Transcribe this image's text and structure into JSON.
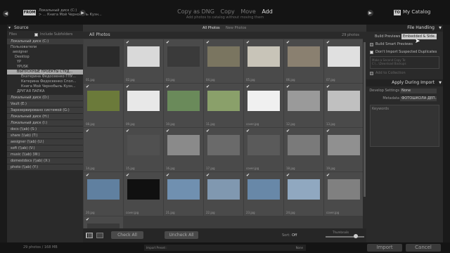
{
  "source": {
    "badge": "FROM",
    "line1": "Локальный диск (C:)",
    "line2": "> ... Книга Мой Чернобыль Кузн..."
  },
  "modes": {
    "copy_dng": "Copy as DNG",
    "copy": "Copy",
    "move": "Move",
    "add": "Add",
    "subtitle": "Add photos to catalog without moving them"
  },
  "dest": {
    "badge": "TO",
    "label": "My Catalog"
  },
  "left": {
    "title": "Source",
    "files_label": "Files",
    "include_subfolders": "Include Subfolders",
    "drives_top": [
      "Локальный диск (C:)"
    ],
    "tree": [
      "Пользователи",
      "aesigner",
      "Desktop",
      "YP",
      "YPUSK",
      "ВЫПУСКНЫЕ ПРОЕКТЫ СТУД...",
      "Екатерина Федосеенко ГПУ...",
      "Катерина Федосеенко Спол...",
      "Книга Мой Чернобыль Кузн...",
      "ДРУГАЯ ПАПКА"
    ],
    "drives": [
      "Локальный диск (D:)",
      "Vault (E:)",
      "Зарезервировано системой (G:)",
      "Локальный диск (H:)",
      "Локальный диск (I:)",
      "docs (\\\\ab) (S:)",
      "share (\\\\ab) (T:)",
      "aesigner (\\\\ab) (U:)",
      "soft (\\\\ab) (V:)",
      "music (\\\\ab) (W:)",
      "domestdocs (\\\\ab) (X:)",
      "photo (\\\\ab) (Y:)"
    ]
  },
  "center": {
    "tab_all": "All Photos",
    "tab_new": "New Photos",
    "grid_title": "All Photos",
    "count": "29 photos",
    "check_all": "Check All",
    "uncheck_all": "Uncheck All",
    "sort_label": "Sort:",
    "sort_value": "Off",
    "thumbnails_label": "Thumbnails",
    "photos": [
      {
        "name": "01.jpg",
        "check": "",
        "tone": "#2a2a2a",
        "dim": true
      },
      {
        "name": "02.jpg",
        "check": "✔",
        "tone": "#d9d9d9"
      },
      {
        "name": "03.jpg",
        "check": "✔",
        "tone": "#3a3a3a"
      },
      {
        "name": "04.jpg",
        "check": "✔",
        "tone": "#7a7560"
      },
      {
        "name": "05.jpg",
        "check": "✔",
        "tone": "#c8c4b8"
      },
      {
        "name": "06.jpg",
        "check": "✔",
        "tone": "#8a8070"
      },
      {
        "name": "07.jpg",
        "check": "✔",
        "tone": "#e0e0e0"
      },
      {
        "name": "08.jpg",
        "check": "✔",
        "tone": "#6b7a3a"
      },
      {
        "name": "09.jpg",
        "check": "✔",
        "tone": "#e8e8e8"
      },
      {
        "name": "10.jpg",
        "check": "✔",
        "tone": "#6a8a5a"
      },
      {
        "name": "11.jpg",
        "check": "✔",
        "tone": "#8aa06a"
      },
      {
        "name": "cover.jpg",
        "check": "✔",
        "tone": "#f0f0f0"
      },
      {
        "name": "12.jpg",
        "check": "✔",
        "tone": "#9a9a9a"
      },
      {
        "name": "13.jpg",
        "check": "✔",
        "tone": "#c0c0c0"
      },
      {
        "name": "14.jpg",
        "check": "✔",
        "tone": "#4a4a4a"
      },
      {
        "name": "15.jpg",
        "check": "✔",
        "tone": "#505050"
      },
      {
        "name": "16.jpg",
        "check": "✔",
        "tone": "#8a8a8a"
      },
      {
        "name": "17.jpg",
        "check": "✔",
        "tone": "#6a6a6a"
      },
      {
        "name": "cover.jpg",
        "check": "✔",
        "tone": "#5a5a5a"
      },
      {
        "name": "18.jpg",
        "check": "✔",
        "tone": "#7a7a7a"
      },
      {
        "name": "19.jpg",
        "check": "✔",
        "tone": "#909090"
      },
      {
        "name": "20.jpg",
        "check": "✔",
        "tone": "#6080a0"
      },
      {
        "name": "cover.jpg",
        "check": "✔",
        "tone": "#101010"
      },
      {
        "name": "21.jpg",
        "check": "✔",
        "tone": "#7090b0"
      },
      {
        "name": "22.jpg",
        "check": "✔",
        "tone": "#8098b0"
      },
      {
        "name": "23.jpg",
        "check": "✔",
        "tone": "#6888a8"
      },
      {
        "name": "24.jpg",
        "check": "✔",
        "tone": "#90a8c0"
      },
      {
        "name": "cover.jpg",
        "check": "✔",
        "tone": "#808080"
      },
      {
        "name": "25.jpg",
        "check": "✔",
        "tone": "#3a3a3a"
      }
    ]
  },
  "right": {
    "file_handling": "File Handling",
    "build_previews_label": "Build Previews",
    "build_previews_value": "Embedded & Side...",
    "opt_smart": "Build Smart Previews",
    "opt_dupes": "Don't Import Suspected Duplicates",
    "opt_second": "Make a Second Copy To:",
    "second_path": "C:\\...\\Download Backups",
    "opt_collection": "Add to Collection",
    "apply_during": "Apply During Import",
    "develop_label": "Develop Settings",
    "develop_value": "None",
    "metadata_label": "Metadata",
    "metadata_value": "ФОТОШКОЛА ДЕП...",
    "keywords_label": "Keywords"
  },
  "bottom": {
    "info": "29 photos / 168 MB",
    "preset_label": "Import Preset :",
    "preset_value": "None",
    "import": "Import",
    "cancel": "Cancel"
  }
}
